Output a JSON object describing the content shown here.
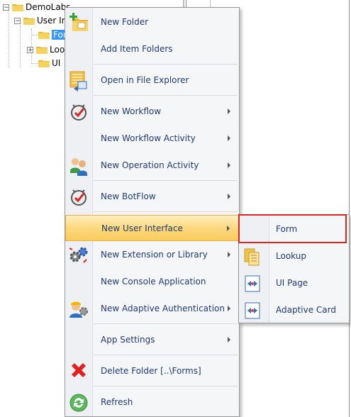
{
  "tree": {
    "nodes": [
      {
        "label": "DemoLabs"
      },
      {
        "label": "User In"
      },
      {
        "label": "For"
      },
      {
        "label": "Loo"
      },
      {
        "label": "UI"
      }
    ]
  },
  "context_menu": {
    "items": [
      {
        "label": "New Folder",
        "icon": "new-folder-icon"
      },
      {
        "label": "Add Item Folders",
        "icon": ""
      },
      {
        "label": "Open in File Explorer",
        "icon": "file-explorer-icon"
      },
      {
        "label": "New Workflow",
        "icon": "workflow-icon",
        "submenu": true
      },
      {
        "label": "New Workflow Activity",
        "icon": "",
        "submenu": true
      },
      {
        "label": "New Operation Activity",
        "icon": "operation-activity-icon",
        "submenu": true
      },
      {
        "label": "New BotFlow",
        "icon": "botflow-icon",
        "submenu": true
      },
      {
        "label": "New User Interface",
        "icon": "",
        "submenu": true,
        "highlighted": true
      },
      {
        "label": "New Extension or Library",
        "icon": "extension-gears-icon",
        "submenu": true
      },
      {
        "label": "New Console Application",
        "icon": ""
      },
      {
        "label": "New Adaptive Authentication",
        "icon": "adaptive-auth-icon",
        "submenu": true
      },
      {
        "label": "App Settings",
        "icon": "",
        "submenu": true
      },
      {
        "label": "Delete Folder [..\\Forms]",
        "icon": "delete-x-icon"
      },
      {
        "label": "Refresh",
        "icon": "refresh-icon"
      }
    ]
  },
  "submenu": {
    "items": [
      {
        "label": "Form",
        "icon": "",
        "annotated": true
      },
      {
        "label": "Lookup",
        "icon": "lookup-icon"
      },
      {
        "label": "UI Page",
        "icon": "ui-page-icon"
      },
      {
        "label": "Adaptive Card",
        "icon": "adaptive-card-icon"
      }
    ]
  },
  "colors": {
    "menu_text": "#1f3b73",
    "highlight": "#fbd77a",
    "annotation_box": "#e02424",
    "selection": "#3399ff"
  }
}
